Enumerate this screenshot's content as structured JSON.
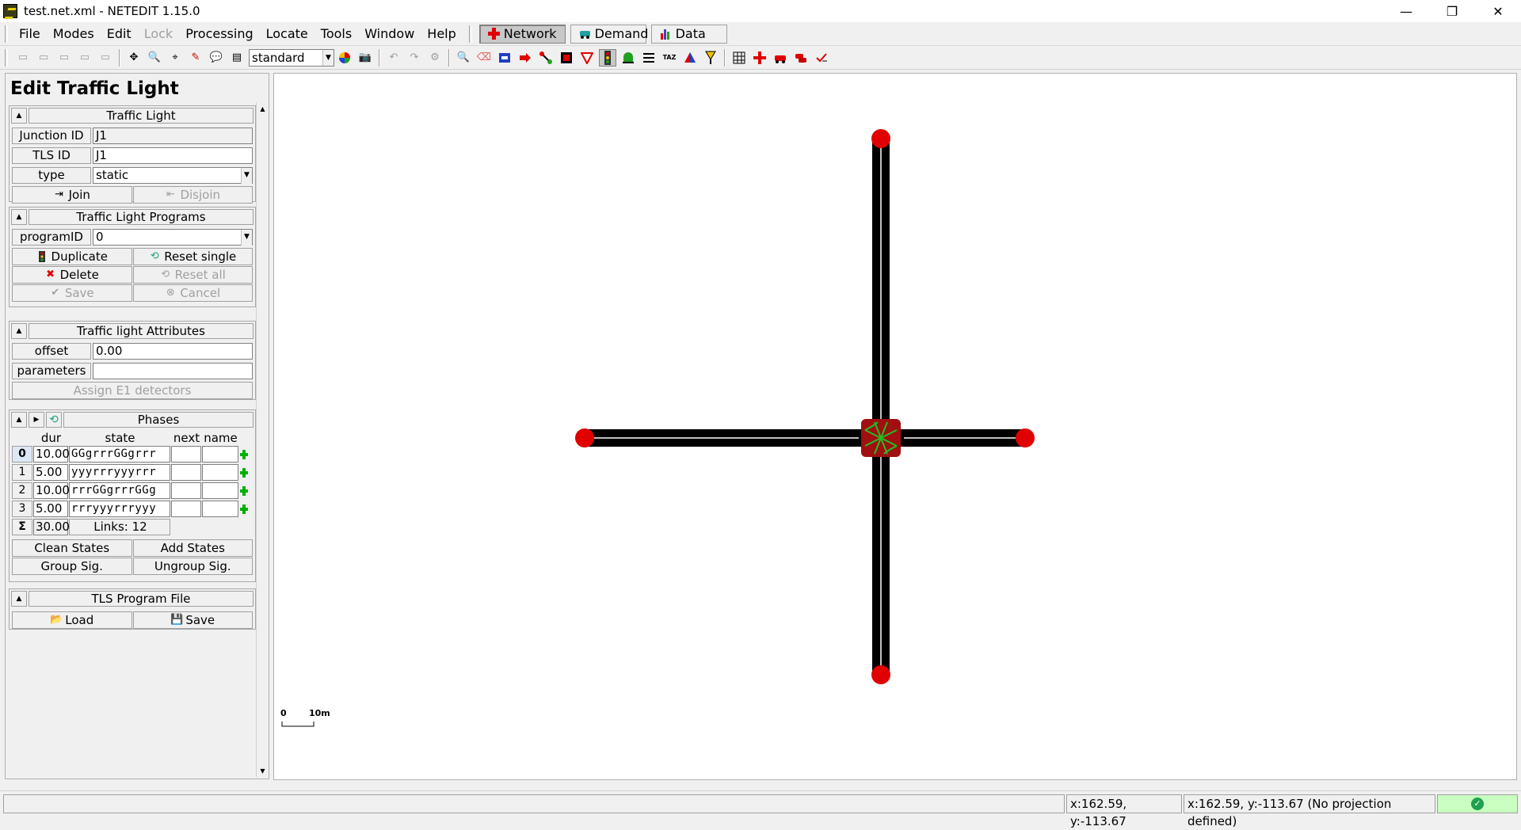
{
  "window": {
    "title": "test.net.xml - NETEDIT 1.15.0",
    "minimize": "—",
    "restore": "❐",
    "close": "✕"
  },
  "menu": {
    "items": [
      "File",
      "Modes",
      "Edit",
      "Lock",
      "Processing",
      "Locate",
      "Tools",
      "Window",
      "Help"
    ],
    "disabled": [
      "Lock"
    ],
    "modes": [
      {
        "label": "Network",
        "active": true,
        "color": "#e00000"
      },
      {
        "label": "Demand",
        "active": false,
        "color": "#20a0a0"
      },
      {
        "label": "Data",
        "active": false,
        "color": "#4040c0"
      }
    ]
  },
  "toolbar": {
    "scheme": "standard"
  },
  "panel": {
    "title": "Edit Traffic Light",
    "traffic_light": {
      "header": "Traffic Light",
      "junction_label": "Junction ID",
      "junction_value": "J1",
      "tls_label": "TLS ID",
      "tls_value": "J1",
      "type_label": "type",
      "type_value": "static",
      "join_label": "Join",
      "disjoin_label": "Disjoin"
    },
    "programs": {
      "header": "Traffic Light Programs",
      "program_label": "programID",
      "program_value": "0",
      "duplicate": "Duplicate",
      "reset_single": "Reset single",
      "delete": "Delete",
      "reset_all": "Reset all",
      "save": "Save",
      "cancel": "Cancel"
    },
    "attributes": {
      "header": "Traffic light Attributes",
      "offset_label": "offset",
      "offset_value": "0.00",
      "parameters_label": "parameters",
      "parameters_value": "",
      "assign_e1": "Assign E1 detectors"
    },
    "phases": {
      "header": "Phases",
      "col_dur": "dur",
      "col_state": "state",
      "col_next": "next",
      "col_name": "name",
      "rows": [
        {
          "idx": "0",
          "dur": "10.00",
          "state": "GGgrrrGGgrrr",
          "next": "",
          "name": ""
        },
        {
          "idx": "1",
          "dur": "5.00",
          "state": "yyyrrryyyrrr",
          "next": "",
          "name": ""
        },
        {
          "idx": "2",
          "dur": "10.00",
          "state": "rrrGGgrrrGGg",
          "next": "",
          "name": ""
        },
        {
          "idx": "3",
          "dur": "5.00",
          "state": "rrryyyrrryyy",
          "next": "",
          "name": ""
        }
      ],
      "sum_symbol": "Σ",
      "total_dur": "30.00",
      "links": "Links: 12",
      "clean_states": "Clean States",
      "add_states": "Add States",
      "group_sig": "Group Sig.",
      "ungroup_sig": "Ungroup Sig."
    },
    "program_file": {
      "header": "TLS Program File",
      "load": "Load",
      "save": "Save"
    }
  },
  "canvas": {
    "scale_zero": "0",
    "scale_label": "10m",
    "road_color": "#000000",
    "node_color": "#e00000"
  },
  "status": {
    "left": "",
    "coords1": "x:162.59, y:-113.67",
    "coords2": "x:162.59, y:-113.67 (No projection defined)",
    "ok": "✓"
  }
}
